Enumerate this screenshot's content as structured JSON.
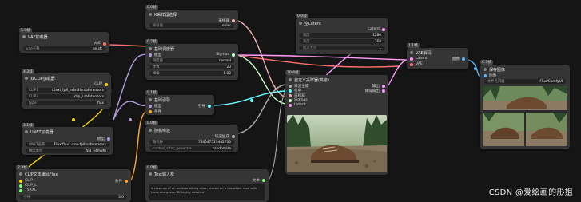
{
  "nodes": {
    "vae_loader": {
      "id": "5.9帧",
      "title": "VAE加载器",
      "vae_label": "VAE",
      "vae_name_label": "vae名称",
      "vae_name_value": "ae.sft"
    },
    "dual_clip": {
      "id": "4.3帧",
      "title": "双CLIP加载器",
      "clip_out": "CLIP",
      "w1_label": "CLIP1",
      "w1_value": "t5xxl_fp8_e4m3fn.safetensors",
      "w2_label": "CLIP2",
      "w2_value": "clip_l.safetensors",
      "w3_label": "type",
      "w3_value": "flux"
    },
    "unet": {
      "id": "3.1帧",
      "title": "UNET加载器",
      "model_out": "模型",
      "w1_label": "UNET名称",
      "w1_value": "Flux\\flux1-dev-fp8.safetensors",
      "w2_label": "精度类型",
      "w2_value": "fp8_e4m3fn"
    },
    "clip_text": {
      "id": "2.3帧",
      "title": "CLIP文本编码Flux",
      "clip_in": "CLIP",
      "cond_out": "条件",
      "r1": "CLIP_L",
      "r2": "T5XXL",
      "w_label": "引导",
      "w_value": "3.0"
    },
    "ksampler_select": {
      "id": "0.0帧",
      "title": "K采样器选择",
      "out": "采样器",
      "w_label": "采样器",
      "w_value": "euler"
    },
    "basic_sched": {
      "id": "0.2帧",
      "title": "基础调度器",
      "in_model": "模型",
      "out": "Sigmas",
      "w1_label": "调度器",
      "w1_value": "normal",
      "w2_label": "步数",
      "w2_value": "20",
      "w3_label": "降噪",
      "w3_value": "1.00"
    },
    "basic_guider": {
      "id": "0.1帧",
      "title": "基础引导",
      "in1": "模型",
      "in2": "条件",
      "out": "引导"
    },
    "random_noise": {
      "id": "0.0帧",
      "title": "随机噪波",
      "out": "噪波生成",
      "w1_label": "随机种",
      "w1_value": "746047525482730",
      "w2_label": "control_after_generate",
      "w2_value": "randomize"
    },
    "empty_latent": {
      "id": "0.0帧",
      "title": "空Latent",
      "out": "Latent",
      "w1_label": "宽度",
      "w1_value": "1280",
      "w2_label": "高度",
      "w2_value": "768",
      "w3_label": "批次大小",
      "w3_value": "1"
    },
    "custom_sampler": {
      "id": "70.4帧",
      "title": "自定义采样器(高级)",
      "in1": "噪波生成",
      "in2": "引导",
      "in3": "采样器",
      "in4": "Sigmas",
      "in5": "Latent",
      "out1": "输出",
      "out2": "降噪输出"
    },
    "vae_decode": {
      "id": "1.1帧",
      "title": "VAE解码",
      "in1": "Latent",
      "in2": "VAE",
      "out": "图像"
    },
    "save_image": {
      "id": "0.7帧",
      "title": "保存图像",
      "in": "图像",
      "w_label": "文件名前缀",
      "w_value": "Flux/ComfyUI"
    },
    "text_node": {
      "id": "0.0帧",
      "title": "Text输入框",
      "out": "文本",
      "text": "A close-up of an outdoor hiking shoe, placed on a mountain road with trees and grass, 8K highly detailed"
    }
  },
  "watermark": "CSDN @爱绘画的彤姐",
  "colors": {
    "clip": "#ffd500",
    "model": "#b39ddb",
    "vae": "#ff6e6e",
    "cond": "#ffa931",
    "sampler": "#ecb4b4",
    "sigmas": "#cdffcd",
    "latent": "#ff9cf9",
    "noise": "#b0b0b0",
    "guider": "#66ffff",
    "image": "#64b5f6",
    "string": "#77ff77"
  }
}
